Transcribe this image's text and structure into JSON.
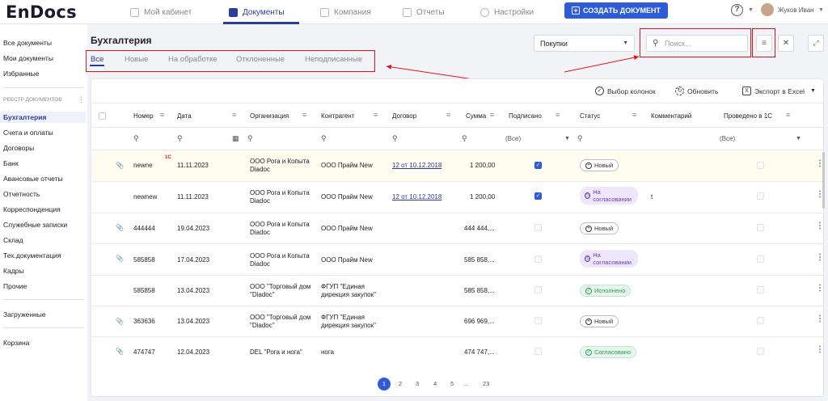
{
  "app": {
    "logo": "EnDocs",
    "user_name": "Жуков Иван",
    "help": "?"
  },
  "topnav": [
    {
      "label": "Мой кабинет",
      "icon": "grid-icon"
    },
    {
      "label": "Документы",
      "icon": "document-icon",
      "active": true
    },
    {
      "label": "Компания",
      "icon": "building-icon"
    },
    {
      "label": "Отчеты",
      "icon": "report-icon"
    },
    {
      "label": "Настройки",
      "icon": "gear-icon"
    }
  ],
  "create_button": "СОЗДАТЬ ДОКУМЕНТ",
  "sidebar": {
    "top": [
      "Все документы",
      "Мои документы",
      "Избранные"
    ],
    "section_title": "РЕЕСТР ДОКУМЕНТОВ",
    "items": [
      "Бухгалтерия",
      "Счета и оплаты",
      "Договоры",
      "Банк",
      "Авансовые отчеты",
      "Отчетность",
      "Корреспонденция",
      "Служебные записки",
      "Склад",
      "Тех.документация",
      "Кадры",
      "Прочие"
    ],
    "loaded": "Загруженные",
    "trash": "Корзина"
  },
  "page": {
    "title": "Бухгалтерия",
    "tabs": [
      "Все",
      "Новые",
      "На обработке",
      "Отклоненные",
      "Неподписанные"
    ],
    "type_select": "Покупки",
    "search_placeholder": "Поиск..."
  },
  "toolbar": {
    "columns": "Выбор колонок",
    "refresh": "Обновить",
    "export": "Экспорт в Excel"
  },
  "table": {
    "headers": [
      "Номер",
      "Дата",
      "Организация",
      "Контрагент",
      "Договор",
      "Сумма",
      "Подписано",
      "Статус",
      "Комментарий",
      "Проведено в 1С"
    ],
    "filter_all": "(Все)",
    "rows": [
      {
        "num": "newne",
        "mark": "1С",
        "date": "11.11.2023",
        "org": "ООО Рога и Копыта Diadoc",
        "contr": "ООО Прайм New",
        "contract": "12 от 10.12.2018",
        "sum": "1 200,00",
        "signed": true,
        "status": "Новый",
        "comment": "",
        "clip": true
      },
      {
        "num": "newnew",
        "mark": "",
        "date": "11.11.2023",
        "org": "ООО Рога и Копыта Diadoc",
        "contr": "ООО Прайм New",
        "contract": "12 от 10.12.2018",
        "sum": "1 200,00",
        "signed": true,
        "status": "На согласовании",
        "comment": "t",
        "clip": false
      },
      {
        "num": "444444",
        "mark": "",
        "date": "19.04.2023",
        "org": "ООО Рога и Копыта Diadoc",
        "contr": "ООО Прайм New",
        "contract": "",
        "sum": "444 444,...",
        "signed": false,
        "status": "Новый",
        "comment": "",
        "clip": true
      },
      {
        "num": "585858",
        "mark": "",
        "date": "17.04.2023",
        "org": "ООО Рога и Копыта Diadoc",
        "contr": "ООО Прайм New",
        "contract": "",
        "sum": "585 858,...",
        "signed": false,
        "status": "На согласовании",
        "comment": "",
        "clip": true
      },
      {
        "num": "585858",
        "mark": "",
        "date": "13.04.2023",
        "org": "ООО \"Торговый дом \"Diadoc\"",
        "contr": "ФГУП \"Единая дирекция закупок\"",
        "contract": "",
        "sum": "585 858,...",
        "signed": false,
        "status": "Исполнено",
        "comment": "",
        "clip": false
      },
      {
        "num": "363636",
        "mark": "",
        "date": "13.04.2023",
        "org": "ООО \"Торговый дом \"Diadoc\"",
        "contr": "ФГУП \"Единая дирекция закупок\"",
        "contract": "",
        "sum": "696 969,...",
        "signed": false,
        "status": "Новый",
        "comment": "",
        "clip": true
      },
      {
        "num": "474747",
        "mark": "",
        "date": "12.04.2023",
        "org": "DEL \"Рога и нога\"",
        "contr": "нога",
        "contract": "",
        "sum": "474 747,...",
        "signed": false,
        "status": "Согласовано",
        "comment": "",
        "clip": true
      }
    ]
  },
  "pagination": [
    "1",
    "2",
    "3",
    "4",
    "5",
    "...",
    "23"
  ],
  "colors": {
    "accent": "#2e5bd7",
    "brand": "#2b3d9b",
    "annotation": "#e0141e"
  }
}
